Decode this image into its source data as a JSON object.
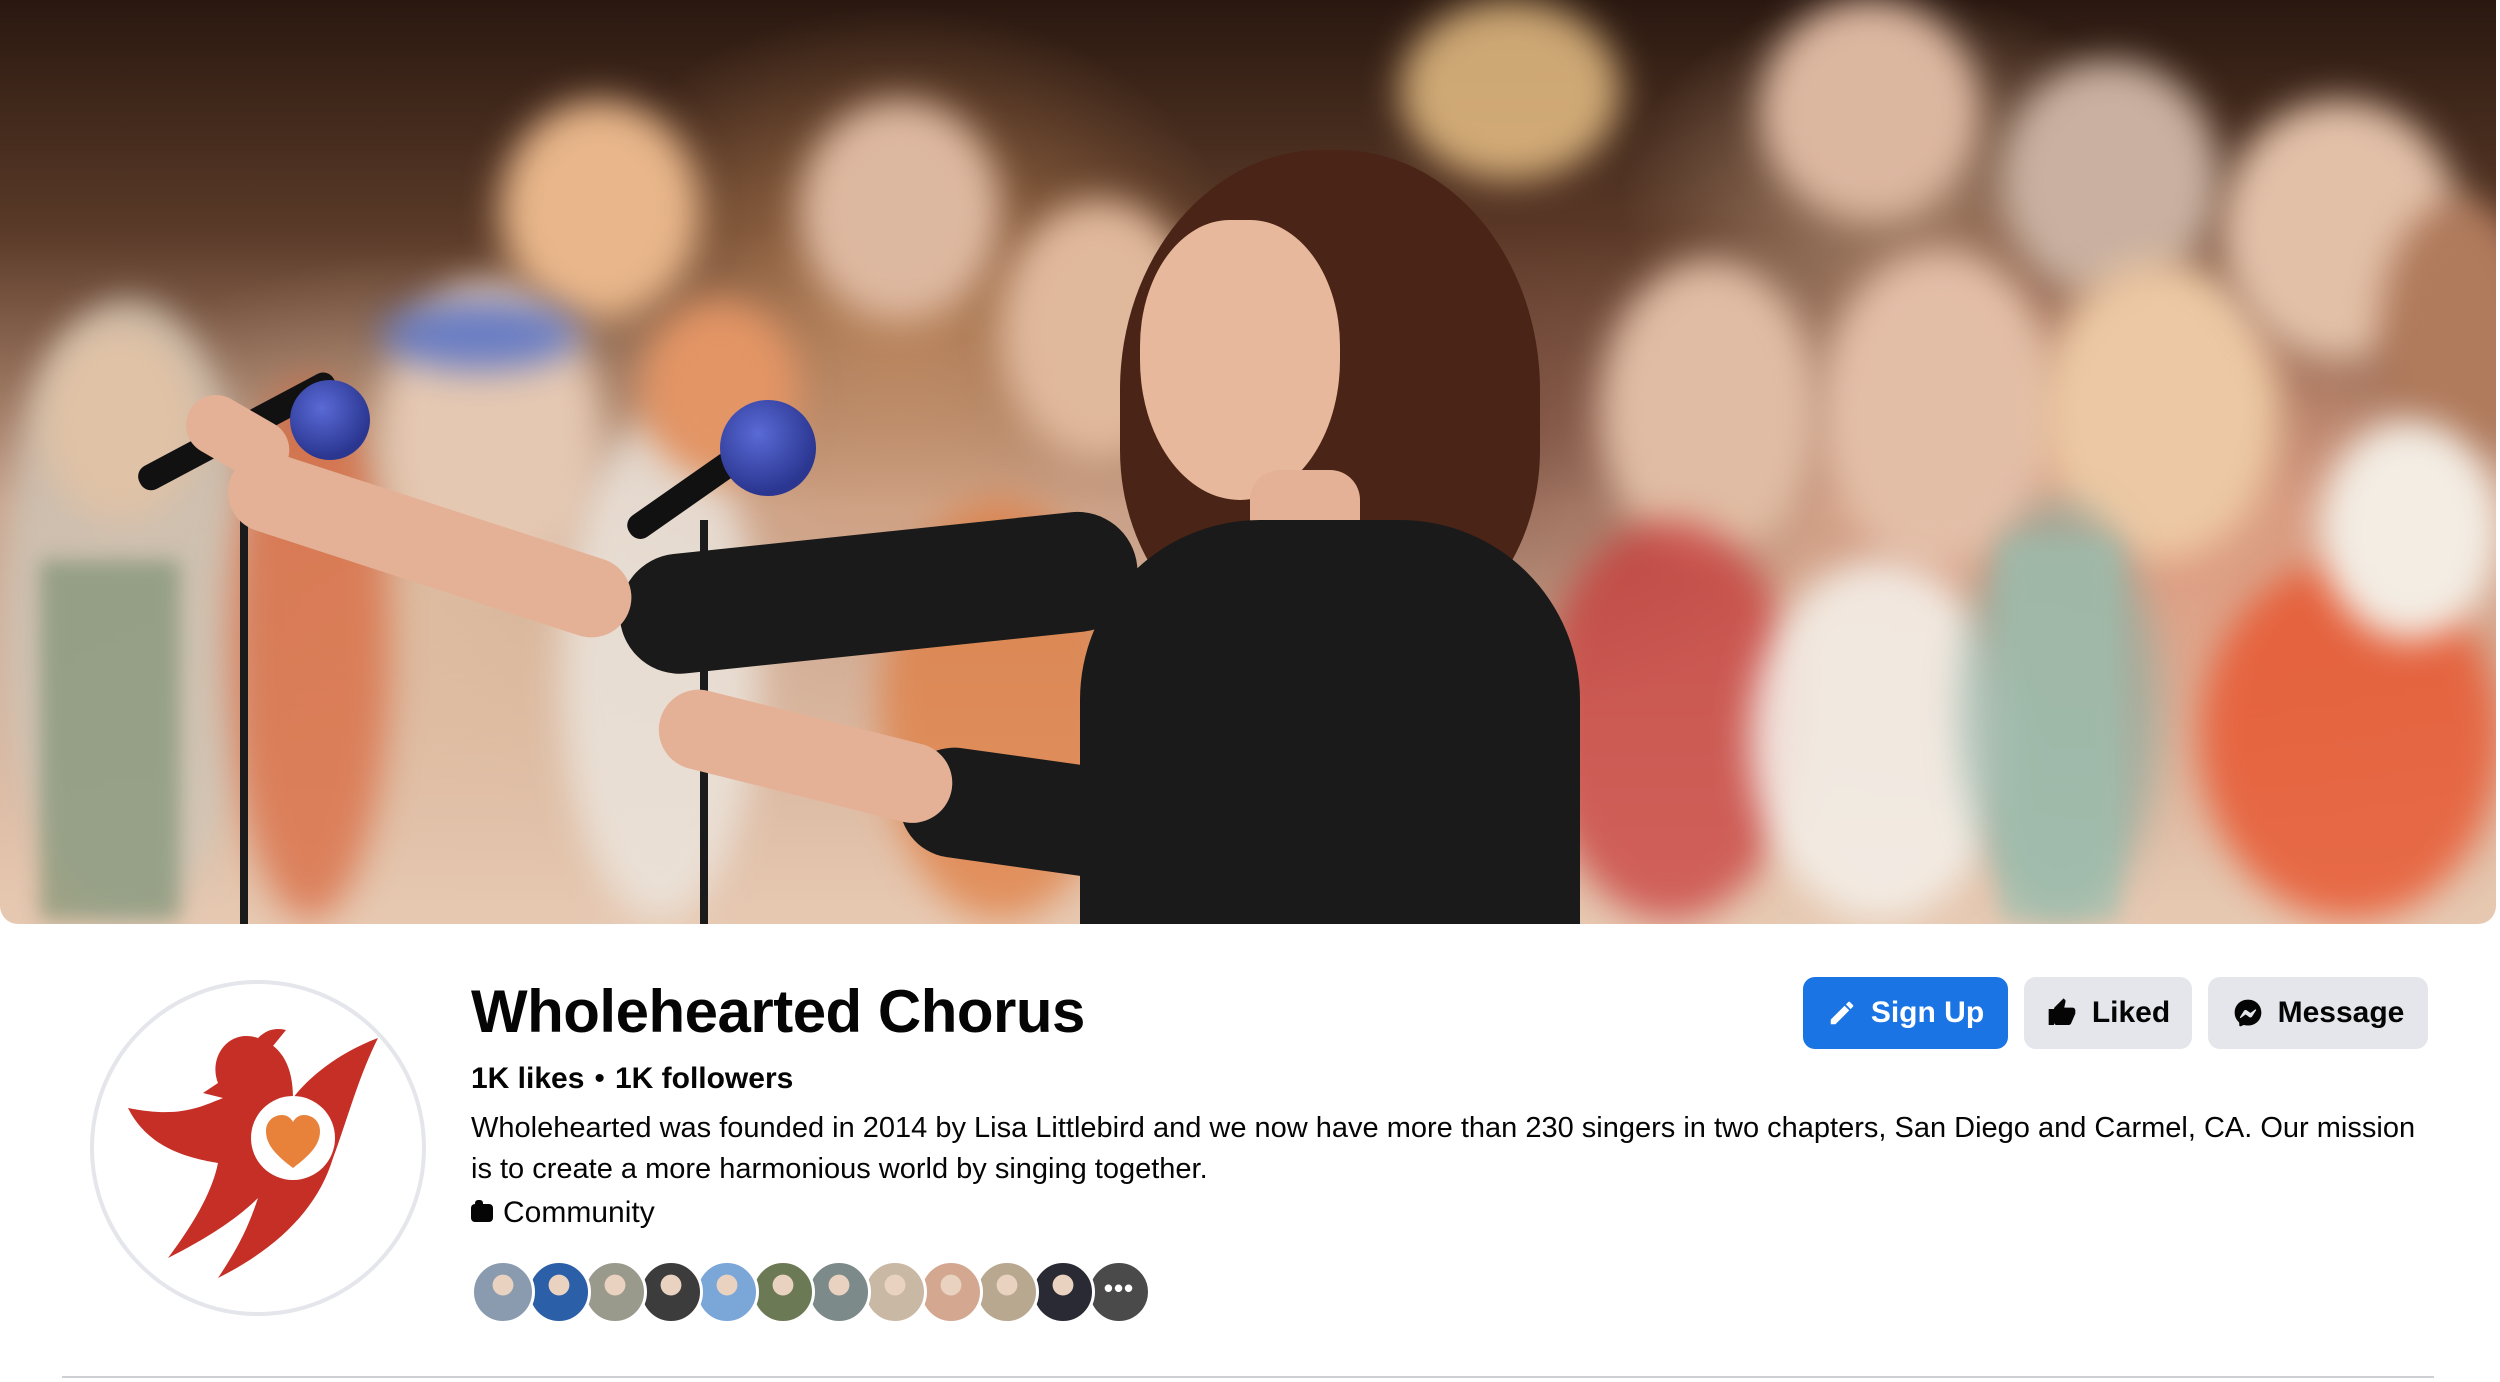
{
  "cover": {
    "description_icon": "cover-photo"
  },
  "profile": {
    "name": "Wholehearted Chorus",
    "likes": "1K likes",
    "separator": "•",
    "followers": "1K followers",
    "about": "Wholehearted was founded in 2014 by Lisa Littlebird and we now have more than 230 singers in two chapters, San Diego and Carmel, CA. Our mission is to create a more harmonious world by singing together.",
    "category": "Community",
    "logo_colors": {
      "bird": "#c62f26",
      "heart": "#e8823a"
    }
  },
  "actions": {
    "signup_label": "Sign Up",
    "liked_label": "Liked",
    "message_label": "Message"
  },
  "friends": {
    "count_shown": 12,
    "colors": [
      "#8a9bb0",
      "#2b5fa8",
      "#9a9a8c",
      "#3c3c3c",
      "#7aa6d8",
      "#6b7a55",
      "#7c8a8a",
      "#c9b8a4",
      "#d4a890",
      "#b8a890",
      "#2a2a35",
      "#4a4a4a"
    ]
  },
  "theme": {
    "accent": "#1b74e4",
    "secondary_button": "#e4e6eb"
  }
}
